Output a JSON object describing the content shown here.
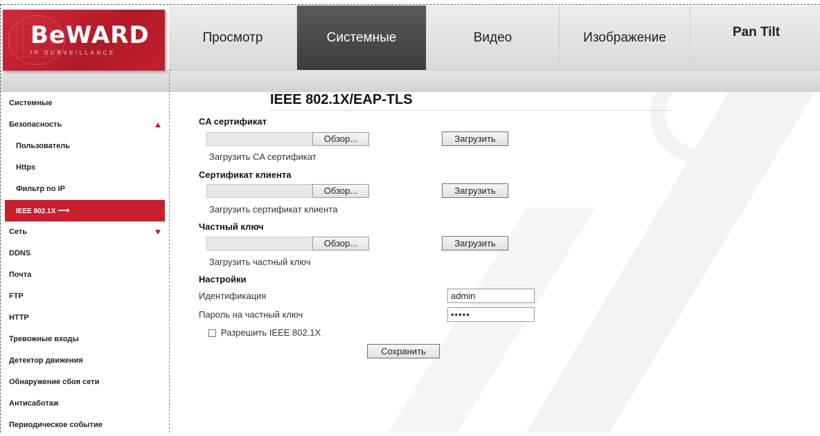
{
  "brand": {
    "logo": "BeWARD",
    "tagline": "IP SURVEILLANCE"
  },
  "nav": {
    "tabs": [
      {
        "label": "Просмотр"
      },
      {
        "label": "Системные",
        "active": true
      },
      {
        "label": "Видео"
      },
      {
        "label": "Изображение"
      },
      {
        "label": "Pan Tilt"
      }
    ]
  },
  "sidebar": {
    "items": [
      {
        "label": "Системные"
      },
      {
        "label": "Безопасность"
      },
      {
        "label": "Пользователь"
      },
      {
        "label": "Https"
      },
      {
        "label": "Фильтр по IP"
      },
      {
        "label": "IEEE 802.1X",
        "active": true
      },
      {
        "label": "Сеть"
      },
      {
        "label": "DDNS"
      },
      {
        "label": "Почта"
      },
      {
        "label": "FTP"
      },
      {
        "label": "HTTP"
      },
      {
        "label": "Тревожные входы"
      },
      {
        "label": "Детектор движения"
      },
      {
        "label": "Обнаружение сбоя сети"
      },
      {
        "label": "Антисаботаж"
      },
      {
        "label": "Периодическое событие"
      }
    ]
  },
  "main": {
    "title": "IEEE 802.1X/EAP-TLS",
    "ca": {
      "label": "CA сертификат",
      "browse": "Обзор...",
      "upload": "Загрузить",
      "hint": "Загрузить CA сертификат"
    },
    "client": {
      "label": "Сертификат клиента",
      "browse": "Обзор...",
      "upload": "Загрузить",
      "hint": "Загрузить сертификат клиента"
    },
    "key": {
      "label": "Частный ключ",
      "browse": "Обзор...",
      "upload": "Загрузить",
      "hint": "Загрузить частный ключ"
    },
    "settings": {
      "label": "Настройки",
      "identity_label": "Идентификация",
      "identity_value": "admin",
      "password_label": "Пароль на частный ключ",
      "password_value": "•••••",
      "enable_label": "Разрешить IEEE 802.1X",
      "enable_checked": false,
      "save": "Сохранить"
    }
  },
  "colors": {
    "accent": "#c8202f",
    "active_tab": "#4a4a4a",
    "watermark": "#f2f2f2"
  }
}
